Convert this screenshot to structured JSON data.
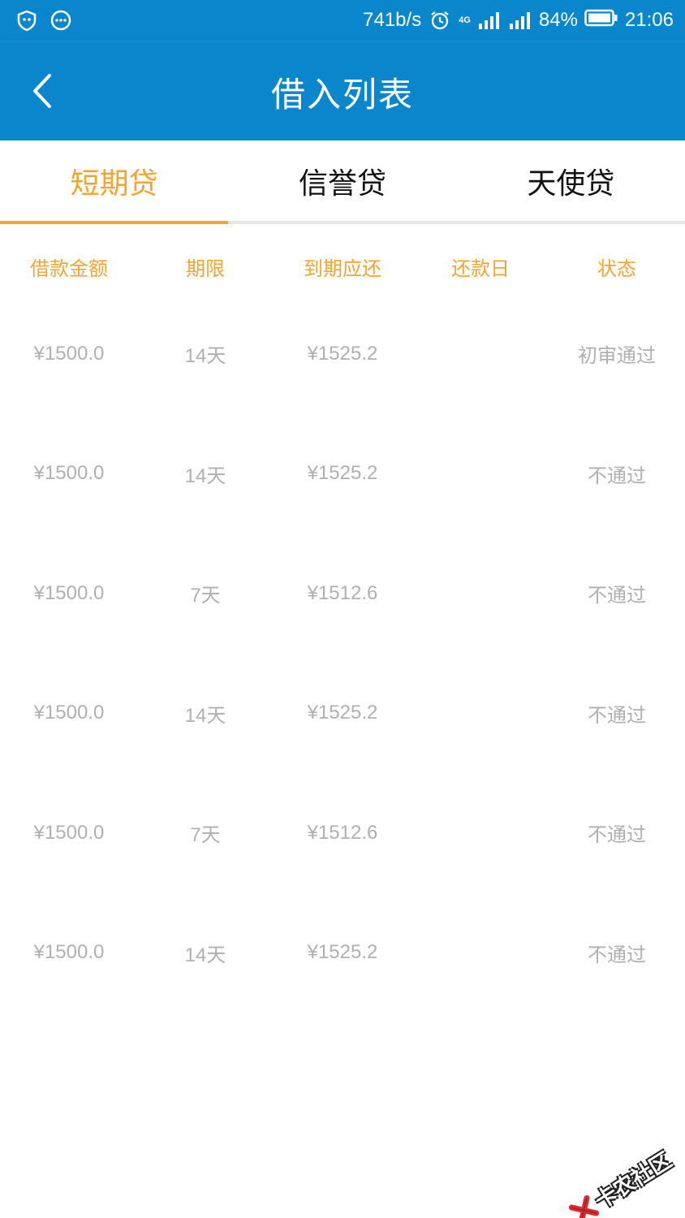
{
  "status_bar": {
    "net_speed": "741b/s",
    "network": "4G",
    "battery": "84%",
    "time": "21:06"
  },
  "app_bar": {
    "title": "借入列表"
  },
  "tabs": [
    {
      "label": "短期贷",
      "active": true
    },
    {
      "label": "信誉贷",
      "active": false
    },
    {
      "label": "天使贷",
      "active": false
    }
  ],
  "table": {
    "headers": [
      "借款金额",
      "期限",
      "到期应还",
      "还款日",
      "状态"
    ],
    "rows": [
      {
        "amount": "¥1500.0",
        "term": "14天",
        "due": "¥1525.2",
        "repay_date": "",
        "status": "初审通过"
      },
      {
        "amount": "¥1500.0",
        "term": "14天",
        "due": "¥1525.2",
        "repay_date": "",
        "status": "不通过"
      },
      {
        "amount": "¥1500.0",
        "term": "7天",
        "due": "¥1512.6",
        "repay_date": "",
        "status": "不通过"
      },
      {
        "amount": "¥1500.0",
        "term": "14天",
        "due": "¥1525.2",
        "repay_date": "",
        "status": "不通过"
      },
      {
        "amount": "¥1500.0",
        "term": "7天",
        "due": "¥1512.6",
        "repay_date": "",
        "status": "不通过"
      },
      {
        "amount": "¥1500.0",
        "term": "14天",
        "due": "¥1525.2",
        "repay_date": "",
        "status": "不通过"
      }
    ]
  },
  "watermark": {
    "text": "卡农社区"
  },
  "colors": {
    "primary": "#0a86cc",
    "accent": "#f3a431",
    "muted_text": "#b0b0b0"
  },
  "icons": {
    "status_left": [
      "shield-icon",
      "chat-bubble-icon"
    ],
    "status_right": [
      "alarm-icon",
      "signal-icon",
      "battery-icon"
    ],
    "app_bar": [
      "back-chevron-icon"
    ]
  }
}
